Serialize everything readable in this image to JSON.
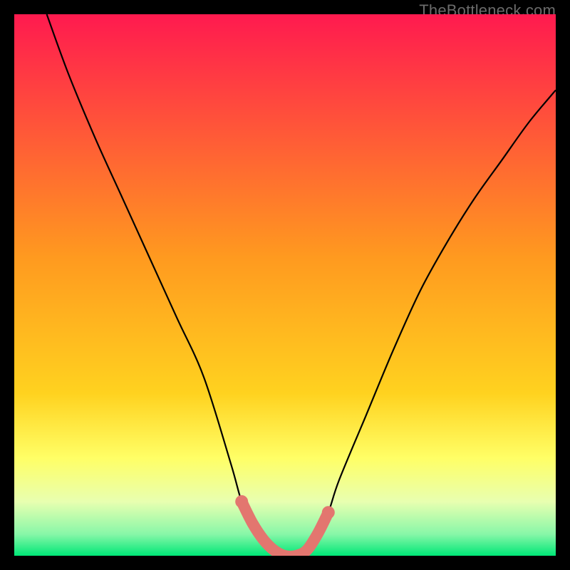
{
  "watermark": "TheBottleneck.com",
  "colors": {
    "top": "#ff1a4f",
    "mid1": "#ff7a1f",
    "mid2": "#ffd21f",
    "mid3": "#ffff66",
    "mid4": "#e8ffb0",
    "bottom": "#00e777",
    "curve": "#000000",
    "marker": "#e3766f",
    "frame": "#000000"
  },
  "chart_data": {
    "type": "line",
    "title": "",
    "xlabel": "",
    "ylabel": "",
    "xlim": [
      0,
      100
    ],
    "ylim": [
      0,
      100
    ],
    "series": [
      {
        "name": "bottleneck-curve",
        "x": [
          6,
          10,
          15,
          20,
          25,
          30,
          35,
          40,
          42,
          44,
          46,
          48,
          50,
          52,
          54,
          56,
          58,
          60,
          65,
          70,
          75,
          80,
          85,
          90,
          95,
          100
        ],
        "values": [
          100,
          89,
          77,
          66,
          55,
          44,
          33,
          17,
          10,
          6,
          3,
          1,
          0,
          0,
          1,
          4,
          8,
          14,
          26,
          38,
          49,
          58,
          66,
          73,
          80,
          86
        ]
      }
    ],
    "markers": {
      "name": "highlight-dots",
      "x": [
        42,
        44,
        46,
        48,
        50,
        52,
        54,
        56,
        58
      ],
      "values": [
        10,
        6,
        3,
        1,
        0,
        0,
        1,
        4,
        8
      ]
    },
    "gradient_bands": [
      {
        "y": 100,
        "color": "#ff1a4f"
      },
      {
        "y": 55,
        "color": "#ff9a1f"
      },
      {
        "y": 30,
        "color": "#ffd21f"
      },
      {
        "y": 18,
        "color": "#ffff66"
      },
      {
        "y": 10,
        "color": "#e8ffb0"
      },
      {
        "y": 3,
        "color": "#88f7a8"
      },
      {
        "y": 0,
        "color": "#00e777"
      }
    ]
  }
}
